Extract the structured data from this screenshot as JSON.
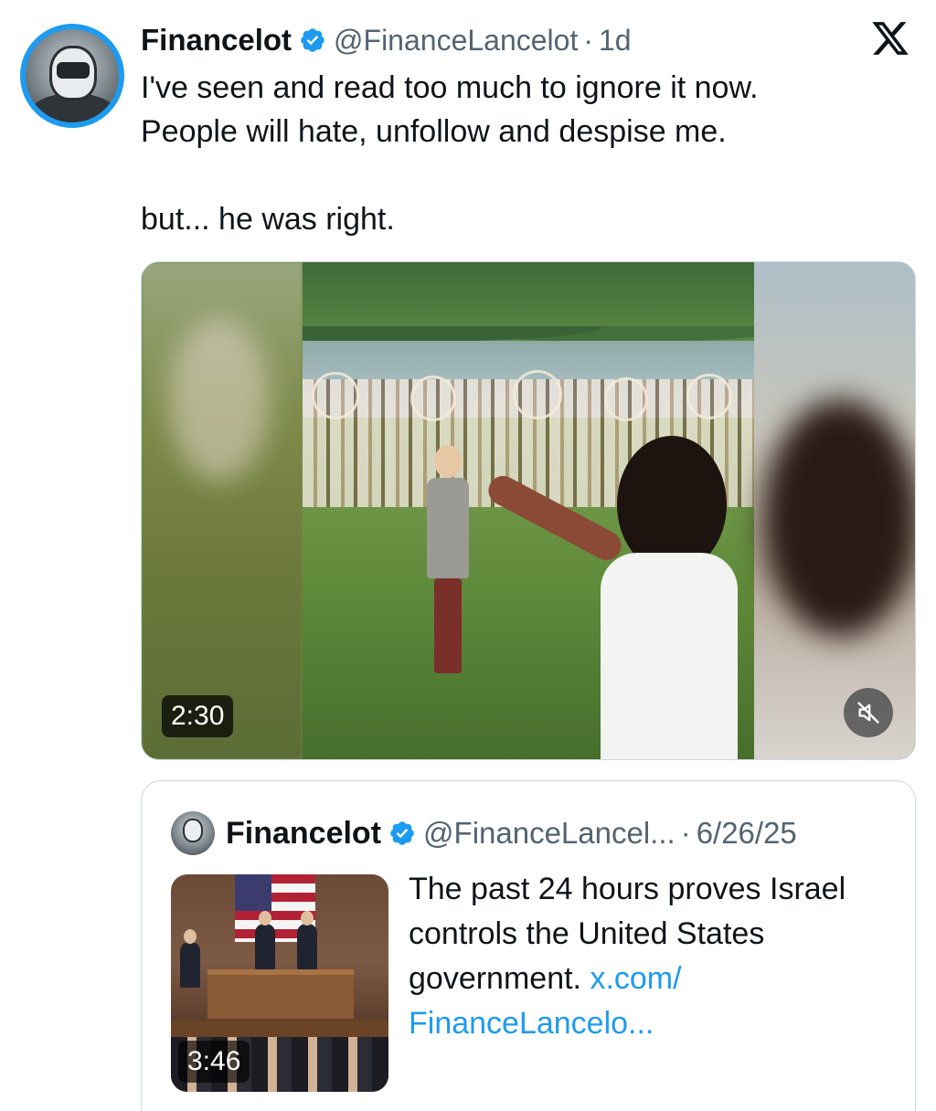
{
  "post": {
    "author_name": "Financelot",
    "handle": "@FinanceLancelot",
    "separator": "·",
    "time": "1d",
    "text_line_1": "I've seen and read too much to ignore it now.",
    "text_line_2": "People will hate, unfollow and despise me.",
    "text_line_3": "but... he was right.",
    "video": {
      "duration": "2:30",
      "muted": true
    }
  },
  "quoted_post": {
    "author_name": "Financelot",
    "handle": "@FinanceLancel...",
    "separator": "·",
    "date": "6/26/25",
    "text": "The past 24 hours proves Israel controls the United States government.",
    "link_line_1": "x.com/",
    "link_line_2": "FinanceLancelo...",
    "video": {
      "duration": "3:46"
    }
  },
  "icons": {
    "verified": "verified-badge-icon",
    "brand": "x-logo-icon",
    "mute": "muted-speaker-icon"
  },
  "colors": {
    "accent": "#1d9bf0",
    "secondary_text": "#536471",
    "primary_text": "#0f1419"
  }
}
